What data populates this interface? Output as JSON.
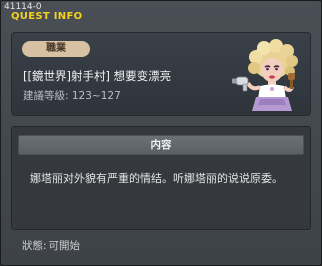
{
  "window": {
    "quest_id": "41114-0",
    "title": "QUEST INFO"
  },
  "header": {
    "job_tag": "職業",
    "quest_name": "[[鏡世界]射手村] 想要变漂亮",
    "level_range": "建議等級: 123~127"
  },
  "content": {
    "header": "内容",
    "description": "娜塔丽对外貌有严重的情结。听娜塔丽的说说原委。"
  },
  "status": {
    "label": "狀態:",
    "value": "可開始"
  },
  "colors": {
    "title": "#f2d21c",
    "job_tag_bg": "#d6c1a2",
    "panel_bg": "#35393e"
  },
  "icons": {
    "close": "close-icon",
    "npc": "npc-portrait"
  }
}
